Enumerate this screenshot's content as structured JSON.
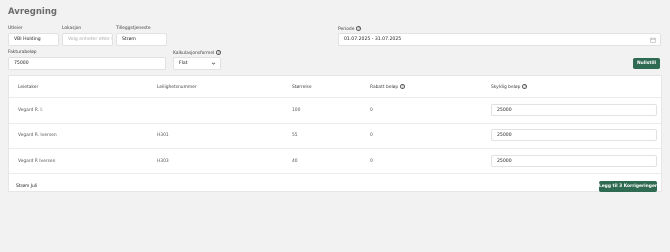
{
  "page": {
    "title": "Avregning"
  },
  "form": {
    "utleier": {
      "label": "Utleier",
      "value": "VBI Holding"
    },
    "lokasjon": {
      "label": "Lokasjon",
      "placeholder": "Velg enheter etter lo"
    },
    "tilleggstjeneste": {
      "label": "Tilleggstjeneste",
      "value": "Strøm"
    },
    "periode": {
      "label": "Periode",
      "value": "01.07.2025 - 31.07.2025"
    },
    "fakturabelop": {
      "label": "Fakturabeløp",
      "value": "75000"
    },
    "kalkulasjonsformel": {
      "label": "Kalkulasjonsformel",
      "value": "Flat"
    },
    "reset_label": "Nullstill"
  },
  "table": {
    "headers": [
      "Leietaker",
      "Leilighetsnummer",
      "Størrelse",
      "Rabatt beløp",
      "Skyldig beløp"
    ],
    "rows": [
      {
        "tenant": "Vegard R. I.",
        "unit": "",
        "size": "100",
        "discount": "0",
        "amount": "25000"
      },
      {
        "tenant": "Vegard R. Iversen",
        "unit": "H301",
        "size": "55",
        "discount": "0",
        "amount": "25000"
      },
      {
        "tenant": "Vegard R Iversen",
        "unit": "H303",
        "size": "40",
        "discount": "0",
        "amount": "25000"
      }
    ],
    "footer_text": "Strøm Juli",
    "submit_label": "Legg til 3 Korrigeringer"
  },
  "colors": {
    "accent": "#2f6b53",
    "background": "#f2f2f2"
  }
}
